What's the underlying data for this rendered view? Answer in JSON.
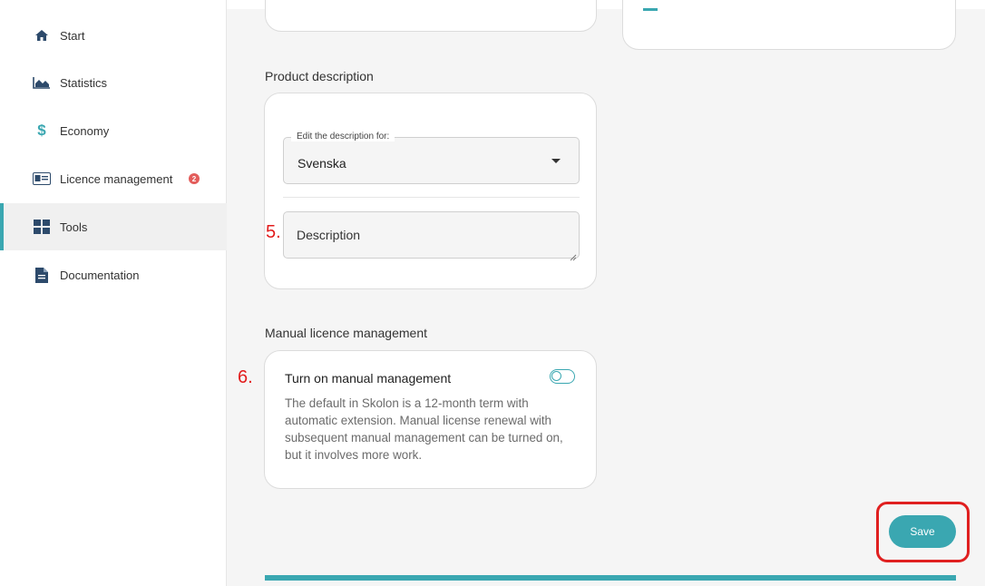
{
  "sidebar": {
    "items": [
      {
        "label": "Start",
        "icon": "home-icon"
      },
      {
        "label": "Statistics",
        "icon": "area-chart-icon"
      },
      {
        "label": "Economy",
        "icon": "dollar-icon"
      },
      {
        "label": "Licence management",
        "icon": "id-card-icon",
        "badge": "2"
      },
      {
        "label": "Tools",
        "icon": "grid-icon",
        "active": true
      },
      {
        "label": "Documentation",
        "icon": "document-icon"
      }
    ]
  },
  "product_description": {
    "title": "Product description",
    "select_legend": "Edit the description for:",
    "select_value": "Svenska",
    "description_placeholder": "Description"
  },
  "manual_licence": {
    "title": "Manual licence management",
    "toggle_label": "Turn on manual management",
    "toggle_on": false,
    "description": "The default in Skolon is a 12-month term with automatic extension. Manual license renewal with subsequent manual management can be turned on, but it involves more work."
  },
  "annotations": {
    "step5": "5.",
    "step6": "6."
  },
  "actions": {
    "save_label": "Save"
  },
  "colors": {
    "accent": "#3aa7b1",
    "annotation": "#e21c1c",
    "badge": "#e35d5b"
  }
}
